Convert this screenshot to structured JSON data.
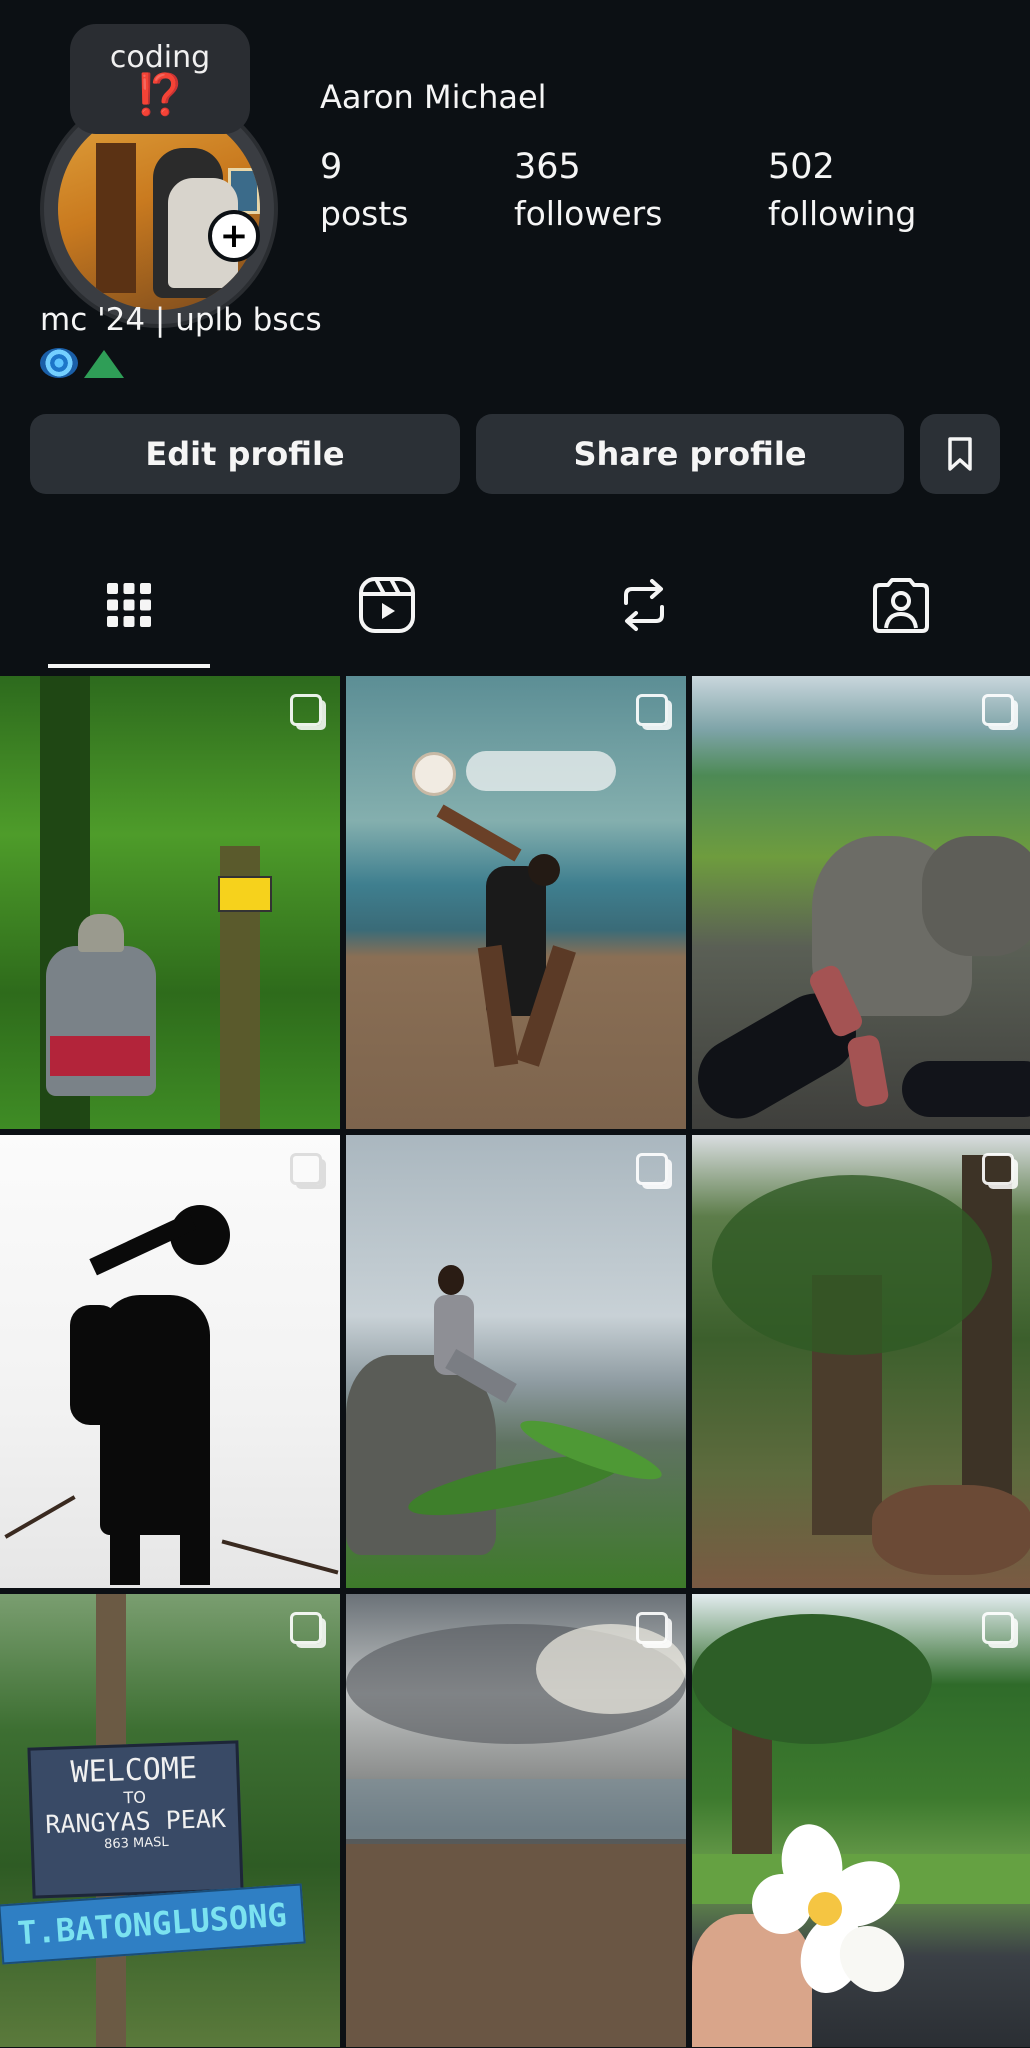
{
  "profile": {
    "note_text": "coding",
    "note_emoji": "⁉️",
    "username": "Aaron Michael",
    "stats": {
      "posts_count": "9",
      "posts_label": "posts",
      "followers_count": "365",
      "followers_label": "followers",
      "following_count": "502",
      "following_label": "following"
    },
    "bio": "mc '24 | uplb bscs",
    "bio_emoji_icons": [
      "swirl-icon",
      "tent-icon"
    ]
  },
  "actions": {
    "edit_label": "Edit profile",
    "share_label": "Share profile",
    "save_icon": "bookmark-icon"
  },
  "tabs": [
    {
      "name": "grid",
      "icon": "grid-icon",
      "active": true
    },
    {
      "name": "reels",
      "icon": "reels-icon",
      "active": false
    },
    {
      "name": "reposts",
      "icon": "repost-icon",
      "active": false
    },
    {
      "name": "tagged",
      "icon": "tagged-person-icon",
      "active": false
    }
  ],
  "posts": {
    "sign1_line1": "WELCOME",
    "sign1_line2": "TO",
    "sign1_line3": "RANGYAS PEAK",
    "sign1_line4": "863 MASL",
    "sign2": "T.BATONGLUSONG"
  },
  "colors": {
    "background": "#0c1014",
    "button": "#2b3036",
    "text": "#f5f5f5",
    "note_emoji": "#f2355f"
  }
}
